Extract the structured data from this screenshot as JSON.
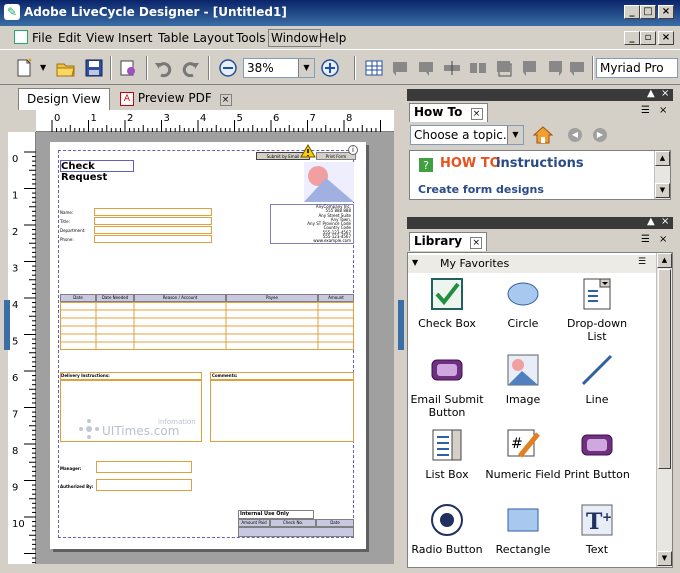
{
  "window": {
    "title": "Adobe LiveCycle Designer - [Untitled1]"
  },
  "menu": [
    "File",
    "Edit",
    "View",
    "Insert",
    "Table",
    "Layout",
    "Tools",
    "Window",
    "Help"
  ],
  "toolbar": {
    "zoom": "38%",
    "font": "Myriad Pro"
  },
  "doc_tabs": {
    "design": "Design View",
    "preview": "Preview PDF"
  },
  "ruler": {
    "h": [
      "0",
      "1",
      "2",
      "3",
      "4",
      "5",
      "6",
      "7",
      "8"
    ],
    "v": [
      "0",
      "1",
      "2",
      "3",
      "4",
      "5",
      "6",
      "7",
      "8",
      "9",
      "10",
      "11"
    ]
  },
  "form": {
    "title": "Check Request",
    "submit_email": "Submit by Email",
    "print_form": "Print Form",
    "company": [
      "AnyCompany Inc.",
      "555 888 888",
      "Any Street Suite",
      "Any Town,",
      "Any ST Province Code",
      "Country Code",
      "555-123-4567",
      "555-123-4567",
      "www.example.com"
    ],
    "fields": [
      "Name:",
      "Title:",
      "Department:",
      "Phone:"
    ],
    "table_headers": [
      "Date",
      "Date Needed",
      "Reason / Account",
      "Payee",
      "Amount"
    ],
    "delivery": "Delivery Instructions:",
    "comments": "Comments:",
    "manager": "Manager:",
    "authorized": "Authorized By:",
    "internal": "Internal Use Only",
    "internal_cols": [
      "Amount Paid",
      "Check No.",
      "Date"
    ],
    "watermark": "UITimes.com",
    "watermark_sub": "infomation"
  },
  "howto": {
    "tab": "How To",
    "select": "Choose a topic...",
    "heading_how": "HOW TO",
    "heading_rest": "instructions",
    "link": "Create form designs"
  },
  "library": {
    "tab": "Library",
    "group": "My Favorites",
    "items": [
      "Check Box",
      "Circle",
      "Drop-down List",
      "Email Submit Button",
      "Image",
      "Line",
      "List Box",
      "Numeric Field",
      "Print Button",
      "Radio Button",
      "Rectangle",
      "Text"
    ]
  },
  "colors": {
    "titlebar": "#0a246a",
    "panelbar": "#3a3a3a",
    "accent": "#3a6ea5",
    "field": "#e0a040",
    "howto": "#e8521c"
  }
}
